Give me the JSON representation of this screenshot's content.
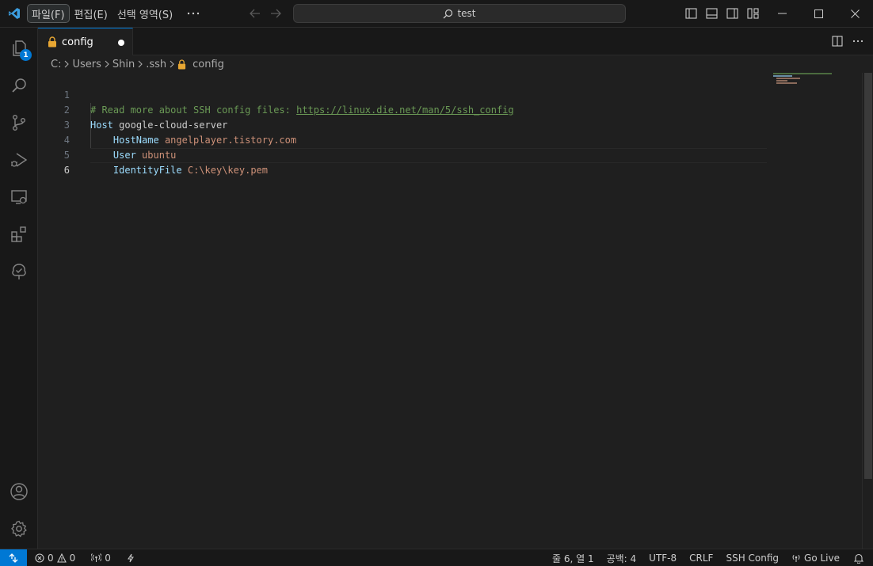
{
  "titlebar": {
    "menu": [
      {
        "label": "파일(F)",
        "active": true
      },
      {
        "label": "편집(E)"
      },
      {
        "label": "선택 영역(S)"
      }
    ],
    "search_text": "test"
  },
  "activitybar": {
    "explorer_badge": "1"
  },
  "tab": {
    "label": "config"
  },
  "breadcrumb": [
    "C:",
    "Users",
    "Shin",
    ".ssh",
    "config"
  ],
  "editor": {
    "lines": [
      {
        "number": "1",
        "comment": "# Read more about SSH config files: ",
        "link": "https://linux.die.net/man/5/ssh_config"
      },
      {
        "number": "2",
        "keyword": "Host",
        "value": "google-cloud-server"
      },
      {
        "number": "3",
        "indent": "    ",
        "keyword": "HostName",
        "value": "angelplayer.tistory.com"
      },
      {
        "number": "4",
        "indent": "    ",
        "keyword": "User",
        "value": "ubuntu"
      },
      {
        "number": "5",
        "indent": "    ",
        "keyword": "IdentityFile",
        "value": "C:\\key\\key.pem"
      },
      {
        "number": "6"
      }
    ]
  },
  "statusbar": {
    "errors": "0",
    "warnings": "0",
    "ports": "0",
    "position": "줄 6, 열 1",
    "spaces": "공백: 4",
    "encoding": "UTF-8",
    "eol": "CRLF",
    "language": "SSH Config",
    "golive": "Go Live"
  },
  "colors": {
    "accent": "#0078d4",
    "comment": "#6a9955",
    "keyword": "#9cdcfe",
    "value": "#ce9178"
  }
}
